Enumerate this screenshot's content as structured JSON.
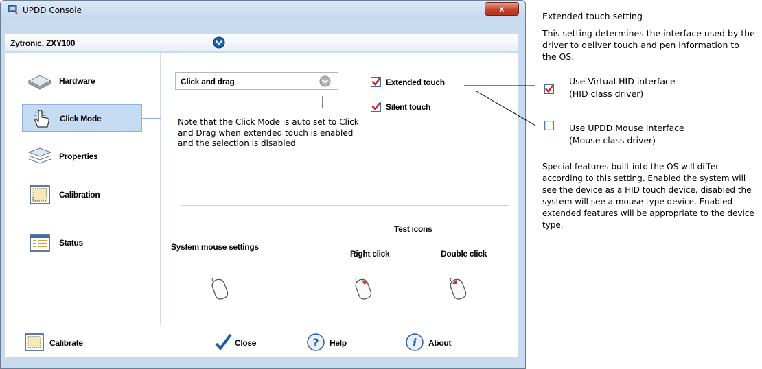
{
  "window": {
    "title": "UPDD Console",
    "close_label": "x",
    "device_selector": "Zytronic, ZXY100"
  },
  "sidebar": {
    "items": [
      {
        "label": "Hardware",
        "icon": "hardware-icon",
        "active": false
      },
      {
        "label": "Click Mode",
        "icon": "hand-pointer-icon",
        "active": true
      },
      {
        "label": "Properties",
        "icon": "layers-icon",
        "active": false
      },
      {
        "label": "Calibration",
        "icon": "calibration-icon",
        "active": false
      },
      {
        "label": "Status",
        "icon": "status-icon",
        "active": false
      }
    ]
  },
  "main": {
    "click_mode_value": "Click and drag",
    "extended_touch": {
      "label": "Extended touch",
      "checked": true
    },
    "silent_touch": {
      "label": "Silent touch",
      "checked": true
    },
    "note": "Note that the Click Mode is auto set to Click and Drag when extended touch is enabled and the selection is disabled",
    "test_icons_label": "Test icons",
    "system_mouse_label": "System mouse settings",
    "right_click_label": "Right click",
    "double_click_label": "Double click"
  },
  "footer": {
    "calibrate_label": "Calibrate",
    "close_label": "Close",
    "help_label": "Help",
    "about_label": "About"
  },
  "annotation": {
    "heading": "Extended touch setting",
    "description": "This setting determines the interface used by the driver to deliver touch and pen information to the OS.",
    "option1_line1": "Use Virtual HID interface",
    "option1_line2": "(HID class driver)",
    "option2_line1": "Use UPDD Mouse Interface",
    "option2_line2": "(Mouse class driver)",
    "footer_text": "Special features built into the OS will differ according to this setting. Enabled the system will see the device as a HID touch device, disabled the system will see a mouse type device. Enabled extended features will be appropriate to the device type."
  },
  "colors": {
    "checkbox_red": "#cc1f1f",
    "accent_blue": "#1f5fa8",
    "selection_blue": "#c5dbf2"
  }
}
